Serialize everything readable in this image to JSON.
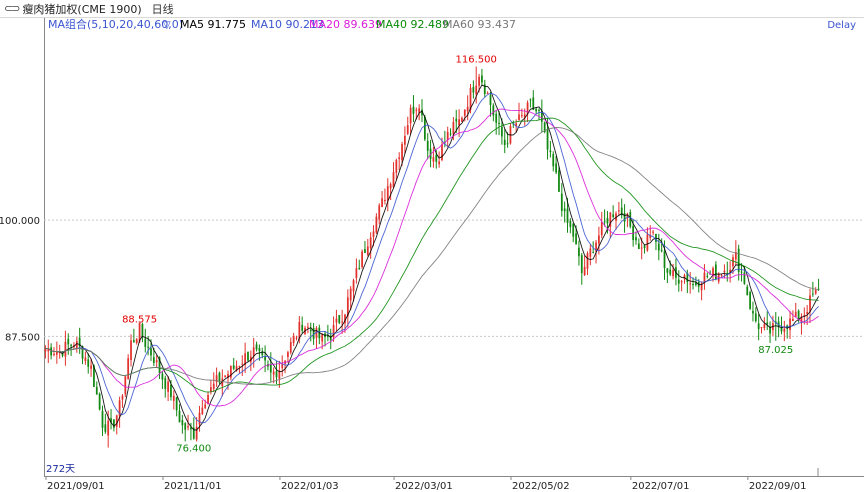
{
  "header": {
    "chain_icon": "chain-link-icon",
    "instrument": "瘦肉猪加权(CME 1900)",
    "period": "日线"
  },
  "legend": {
    "group": "MA组合(5,10,20,40,60,0)",
    "dropdown_icon": "chevron-down-icon",
    "items": [
      {
        "label": "MA5",
        "value": "91.775",
        "color": "#000000"
      },
      {
        "label": "MA10",
        "value": "90.213",
        "color": "#3a55d0"
      },
      {
        "label": "MA20",
        "value": "89.639",
        "color": "#d81bd8"
      },
      {
        "label": "MA40",
        "value": "92.489",
        "color": "#0a8a0a"
      },
      {
        "label": "MA60",
        "value": "93.437",
        "color": "#777777"
      }
    ],
    "status": "Delay"
  },
  "chart_data": {
    "type": "candlestick",
    "y_ticks": [
      "100.000",
      "87.500"
    ],
    "x_ticks": [
      "2021/09/01",
      "2021/11/01",
      "2022/01/03",
      "2022/03/01",
      "2022/05/02",
      "2022/07/01",
      "2022/09/01"
    ],
    "ylim": [
      72.5,
      121.5
    ],
    "annotations": {
      "high": {
        "label": "116.500",
        "value": 116.5,
        "color": "#e00000"
      },
      "local_high": {
        "label": "88.575",
        "value": 88.575,
        "color": "#e00000"
      },
      "low": {
        "label": "76.400",
        "value": 76.4,
        "color": "#118811"
      },
      "recent_low": {
        "label": "87.025",
        "value": 87.025,
        "color": "#118811"
      }
    },
    "bar_count_label": "272天",
    "up_color": "#e2322d",
    "down_color": "#118811",
    "anchors": [
      [
        0,
        86.2
      ],
      [
        5,
        85.9
      ],
      [
        10,
        86.9
      ],
      [
        13,
        85.8
      ],
      [
        16,
        84.1
      ],
      [
        20,
        78.2
      ],
      [
        23,
        77.5
      ],
      [
        26,
        79.9
      ],
      [
        30,
        86.8
      ],
      [
        33,
        88.2
      ],
      [
        35,
        86.8
      ],
      [
        38,
        85.2
      ],
      [
        41,
        83.1
      ],
      [
        44,
        81.4
      ],
      [
        48,
        77.8
      ],
      [
        52,
        77.1
      ],
      [
        55,
        80.5
      ],
      [
        60,
        82.6
      ],
      [
        65,
        83.8
      ],
      [
        70,
        85.3
      ],
      [
        73,
        85.9
      ],
      [
        76,
        84.8
      ],
      [
        79,
        83.4
      ],
      [
        82,
        84.1
      ],
      [
        86,
        86.6
      ],
      [
        90,
        88.9
      ],
      [
        94,
        87.9
      ],
      [
        97,
        87.1
      ],
      [
        100,
        87.7
      ],
      [
        105,
        90.4
      ],
      [
        110,
        95.2
      ],
      [
        114,
        98.8
      ],
      [
        118,
        101.8
      ],
      [
        122,
        105.5
      ],
      [
        125,
        108.4
      ],
      [
        128,
        111.6
      ],
      [
        131,
        112.8
      ],
      [
        134,
        107.6
      ],
      [
        137,
        106.4
      ],
      [
        141,
        109.1
      ],
      [
        145,
        110.6
      ],
      [
        149,
        113.6
      ],
      [
        152,
        115.9
      ],
      [
        155,
        113.5
      ],
      [
        158,
        110.4
      ],
      [
        161,
        108.2
      ],
      [
        164,
        110.1
      ],
      [
        167,
        111.0
      ],
      [
        170,
        112.3
      ],
      [
        173,
        111.4
      ],
      [
        176,
        107.5
      ],
      [
        179,
        104.6
      ],
      [
        182,
        100.2
      ],
      [
        185,
        98.4
      ],
      [
        188,
        94.3
      ],
      [
        191,
        96.6
      ],
      [
        194,
        98.4
      ],
      [
        197,
        100.2
      ],
      [
        200,
        101.2
      ],
      [
        203,
        100.6
      ],
      [
        206,
        98.6
      ],
      [
        209,
        96.8
      ],
      [
        212,
        98.7
      ],
      [
        215,
        96.9
      ],
      [
        218,
        94.6
      ],
      [
        221,
        93.7
      ],
      [
        224,
        94.1
      ],
      [
        227,
        93.0
      ],
      [
        230,
        93.9
      ],
      [
        233,
        94.1
      ],
      [
        236,
        94.4
      ],
      [
        239,
        94.9
      ],
      [
        242,
        96.0
      ],
      [
        245,
        93.5
      ],
      [
        248,
        89.6
      ],
      [
        251,
        88.3
      ],
      [
        254,
        88.0
      ],
      [
        257,
        88.6
      ],
      [
        260,
        88.9
      ],
      [
        263,
        89.4
      ],
      [
        266,
        90.1
      ],
      [
        269,
        91.8
      ],
      [
        271,
        92.2
      ]
    ]
  }
}
